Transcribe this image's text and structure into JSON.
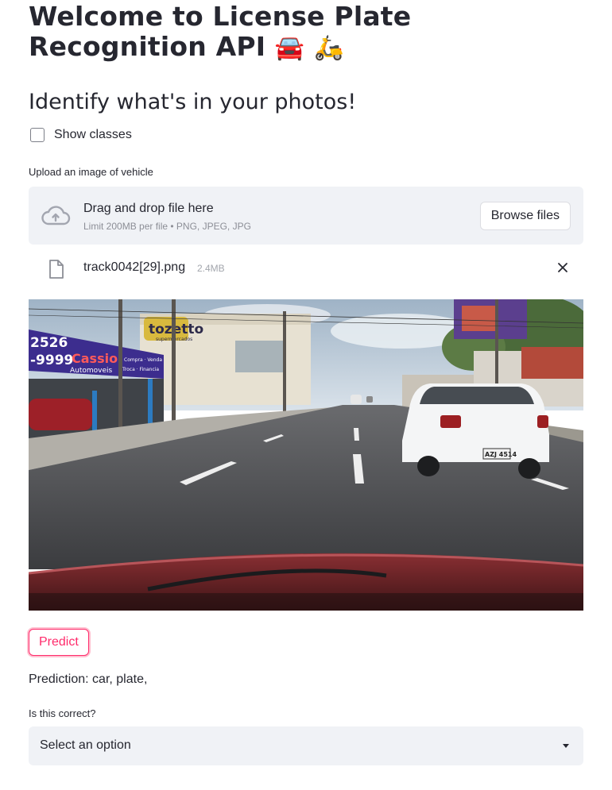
{
  "header": {
    "title": "Welcome to License Plate Recognition API",
    "title_emojis": [
      "🚘",
      "🛵"
    ]
  },
  "subtitle": "Identify what's in your photos!",
  "show_classes": {
    "label": "Show classes",
    "checked": false
  },
  "uploader": {
    "label": "Upload an image of vehicle",
    "drag_text": "Drag and drop file here",
    "limit_text": "Limit 200MB per file • PNG, JPEG, JPG",
    "browse_label": "Browse files",
    "icon": "cloud-upload-icon"
  },
  "uploaded_file": {
    "name": "track0042[29].png",
    "size": "2.4MB",
    "icon": "file-icon",
    "remove_icon": "close-icon"
  },
  "photo": {
    "signs": [
      "tozetto",
      "supermercados",
      "2526",
      "-9999",
      "Cassio",
      "Automoveis",
      "Compra · Venda",
      "Troca · Financia"
    ],
    "plate": "AZJ 4514"
  },
  "predict_button": "Predict",
  "prediction": "Prediction: car, plate,",
  "feedback": {
    "question": "Is this correct?",
    "select_value": "Select an option"
  },
  "colors": {
    "accent": "#ff2b6b",
    "panel_bg": "#f0f2f6",
    "text": "#262730"
  }
}
